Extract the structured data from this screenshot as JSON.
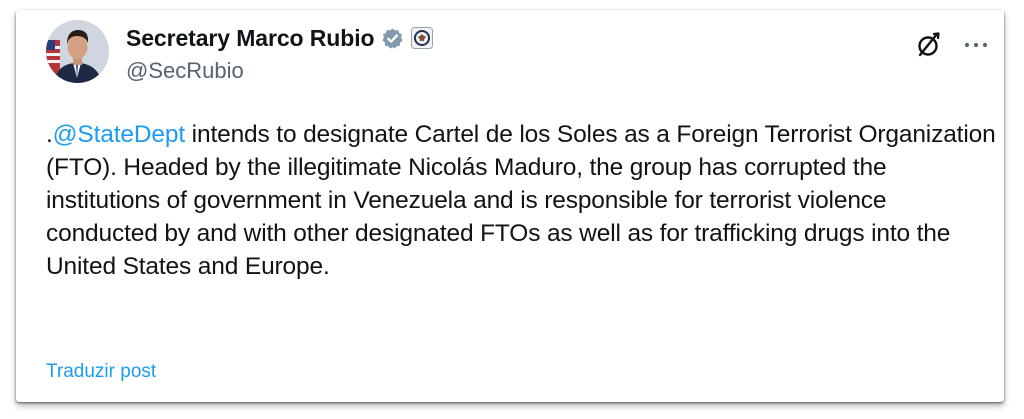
{
  "post": {
    "author": {
      "display_name": "Secretary Marco Rubio",
      "handle": "@SecRubio",
      "verified_badge": "verified-gray-check-icon",
      "affiliation_badge": "state-department-seal-icon"
    },
    "text_prefix": ".",
    "mention": "@StateDept",
    "text_body": " intends to designate Cartel de los Soles as a Foreign Terrorist Organization (FTO). Headed by the illegitimate Nicolás Maduro, the group has corrupted the institutions of government in Venezuela and is responsible for terrorist violence conducted by and with other designated FTOs as well as for trafficking drugs into the United States and Europe.",
    "translate_label": "Traduzir post"
  },
  "icons": {
    "grok": "grok-icon",
    "more": "more-icon"
  },
  "colors": {
    "link": "#1d9bf0",
    "text": "#0f1419",
    "secondary": "#536471",
    "verified_badge": "#829aab"
  }
}
